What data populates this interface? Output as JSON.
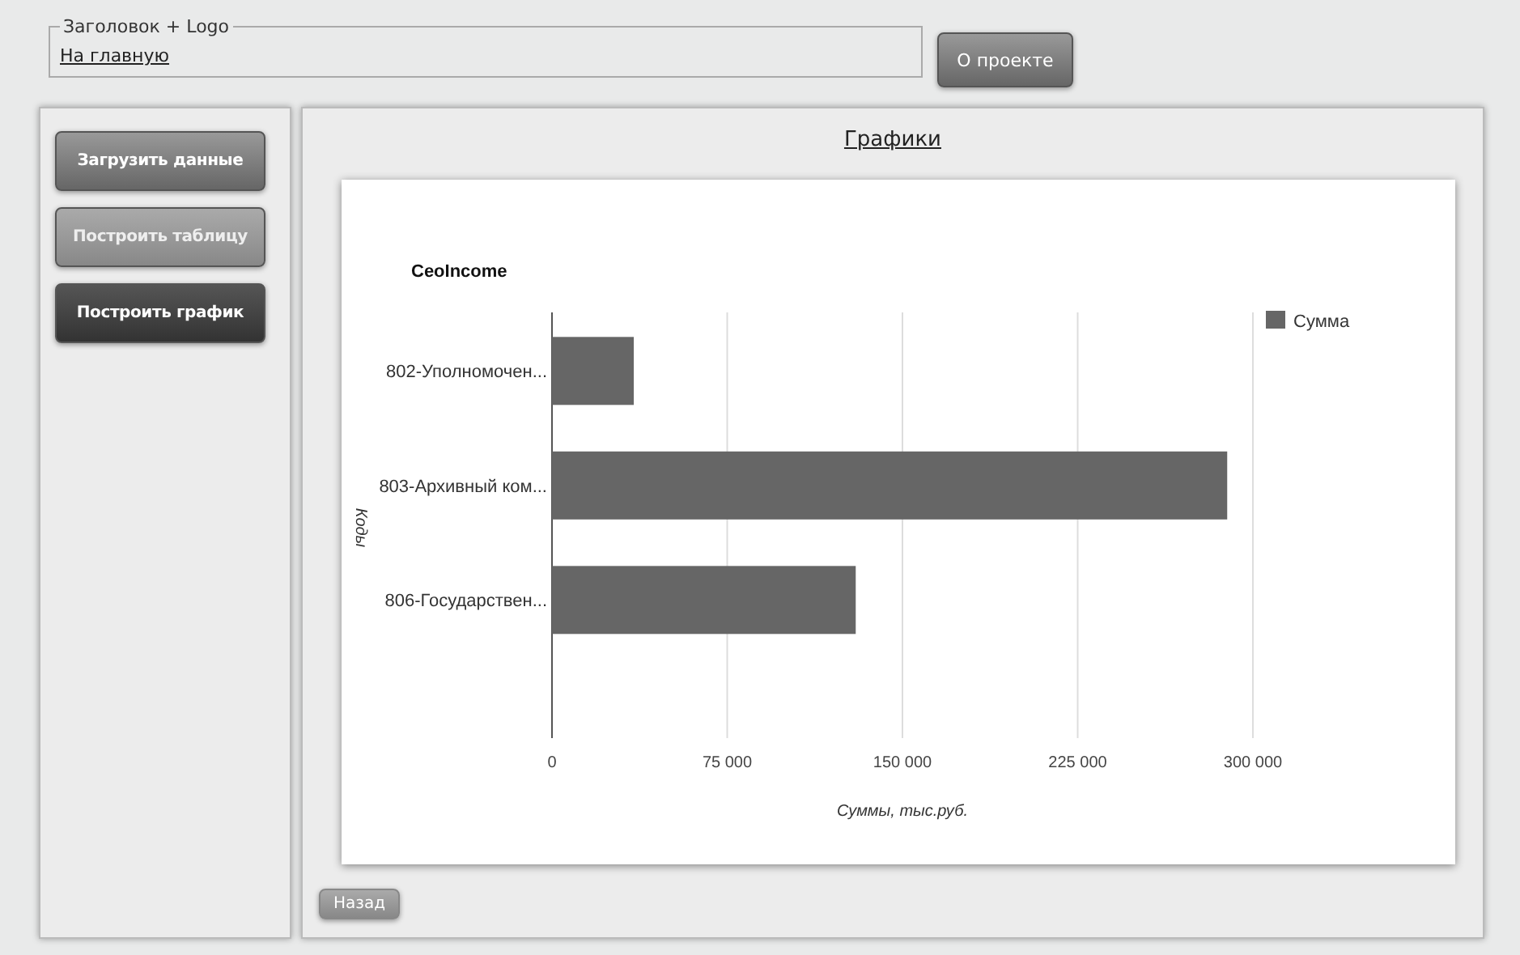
{
  "header": {
    "legend": "Заголовок + Logo",
    "home_link": "На главную",
    "about_button": "О проекте"
  },
  "sidebar": {
    "buttons": [
      {
        "label": "Загрузить данные",
        "selected": false,
        "disabled": false
      },
      {
        "label": "Построить таблицу",
        "selected": false,
        "disabled": true
      },
      {
        "label": "Построить график",
        "selected": true,
        "disabled": false
      }
    ]
  },
  "main": {
    "title": "Графики",
    "back_button": "Назад",
    "chart_data": {
      "type": "bar",
      "orientation": "horizontal",
      "title": "CeoIncome",
      "xlabel": "Суммы, тыс.руб.",
      "ylabel": "Коды",
      "categories": [
        "802-Уполномочен...",
        "803-Архивный ком...",
        "806-Государствен..."
      ],
      "series": [
        {
          "name": "Сумма",
          "color": "#666666",
          "values": [
            35000,
            289000,
            130000
          ]
        }
      ],
      "xlim": [
        0,
        300000
      ],
      "grid": true,
      "xticks": [
        {
          "value": 0,
          "label": "0"
        },
        {
          "value": 75000,
          "label": "75 000"
        },
        {
          "value": 150000,
          "label": "150 000"
        },
        {
          "value": 225000,
          "label": "225 000"
        },
        {
          "value": 300000,
          "label": "300 000"
        }
      ]
    }
  }
}
